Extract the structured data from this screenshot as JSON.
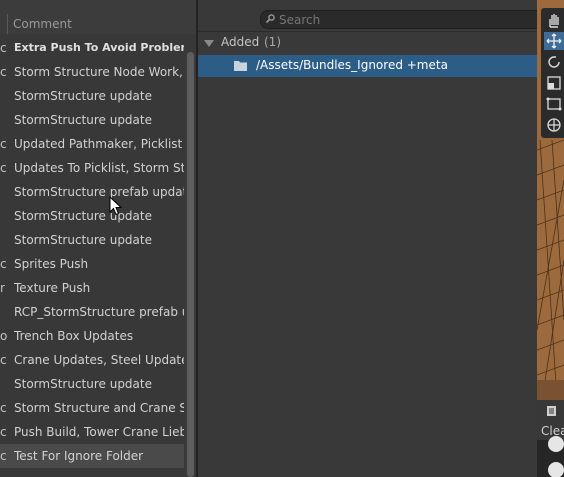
{
  "history": {
    "column_header": "Comment",
    "rows": [
      {
        "prefix": "c",
        "comment": "Extra Push To Avoid Problem",
        "bold": true
      },
      {
        "prefix": "c",
        "comment": "Storm Structure Node Work, Bu"
      },
      {
        "prefix": "",
        "comment": "StormStructure update"
      },
      {
        "prefix": "",
        "comment": "StormStructure update"
      },
      {
        "prefix": "c",
        "comment": "Updated Pathmaker, Picklist P"
      },
      {
        "prefix": "c",
        "comment": "Updates To Picklist, Storm Stru"
      },
      {
        "prefix": "",
        "comment": "StormStructure prefab update"
      },
      {
        "prefix": "",
        "comment": "StormStructure update"
      },
      {
        "prefix": "",
        "comment": "StormStructure update"
      },
      {
        "prefix": "c",
        "comment": "Sprites Push"
      },
      {
        "prefix": "r",
        "comment": "Texture Push"
      },
      {
        "prefix": "",
        "comment": "RCP_StormStructure prefab up"
      },
      {
        "prefix": "o",
        "comment": "Trench Box Updates"
      },
      {
        "prefix": "c",
        "comment": "Crane Updates, Steel Updates"
      },
      {
        "prefix": "",
        "comment": "StormStructure update"
      },
      {
        "prefix": "c",
        "comment": "Storm Structure and Crane Sys"
      },
      {
        "prefix": "c",
        "comment": "Push Build, Tower Crane Liebh"
      },
      {
        "prefix": "c",
        "comment": "Test For Ignore Folder",
        "selected": true
      }
    ]
  },
  "details": {
    "search_placeholder": "Search",
    "group": {
      "label": "Added",
      "count": "(1)"
    },
    "files": [
      {
        "name": "/Assets/Bundles_Ignored +meta",
        "icon": "folder-icon"
      }
    ]
  },
  "console": {
    "clear_label": "Clea"
  },
  "colors": {
    "selection_blue": "#2c5d87",
    "panel_bg": "#383838",
    "scene_bg": "#9c6a3c",
    "tool_active": "#3e6c98"
  }
}
